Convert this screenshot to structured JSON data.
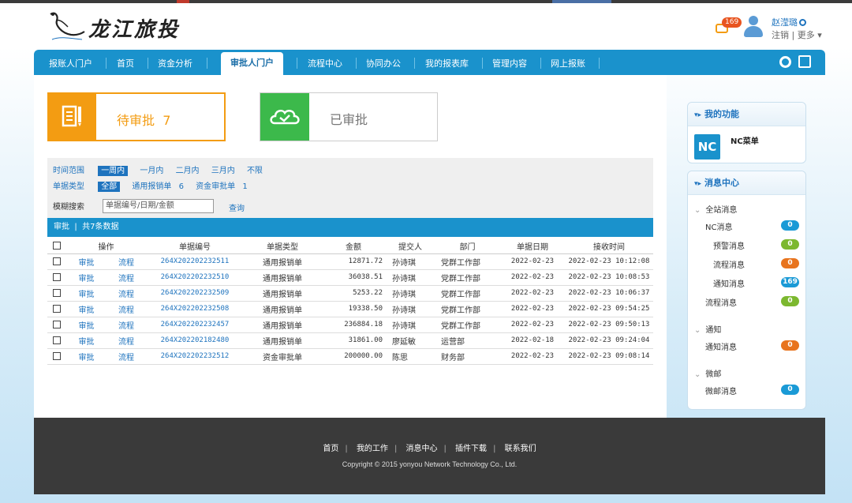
{
  "brand": {
    "logo_text": "龙江旅投"
  },
  "header": {
    "message_count": "169",
    "user_name": "赵滢璐",
    "logout": "注销",
    "separator": "|",
    "more": "更多 ▾"
  },
  "nav": {
    "items": [
      "报账人门户",
      "首页",
      "资金分析",
      "审批人门户",
      "流程中心",
      "协同办公",
      "我的报表库",
      "管理内容",
      "网上报账"
    ]
  },
  "cards": {
    "pending": {
      "label": "待审批",
      "count": "7"
    },
    "done": {
      "label": "已审批"
    }
  },
  "filters": {
    "time_label": "时间范围",
    "time_options": [
      "一周内",
      "一月内",
      "二月内",
      "三月内",
      "不限"
    ],
    "type_label": "单据类型",
    "type_all": "全部",
    "type_options": [
      {
        "name": "通用报销单",
        "count": "6"
      },
      {
        "name": "资金审批单",
        "count": "1"
      }
    ],
    "search_label": "模糊搜索",
    "search_placeholder": "单据编号/日期/金额",
    "search_button": "查询"
  },
  "table": {
    "bar_title": "审批",
    "bar_sep": "|",
    "bar_count": "共7条数据",
    "headers": [
      "操作",
      "单据编号",
      "单据类型",
      "金额",
      "提交人",
      "部门",
      "单据日期",
      "接收时间"
    ],
    "rows": [
      {
        "action1": "审批",
        "action2": "流程",
        "code": "264X202202232511",
        "type": "通用报销单",
        "amount": "12871.72",
        "submitter": "孙诗琪",
        "dept": "党群工作部",
        "date": "2022-02-23",
        "received": "2022-02-23 10:12:08"
      },
      {
        "action1": "审批",
        "action2": "流程",
        "code": "264X202202232510",
        "type": "通用报销单",
        "amount": "36038.51",
        "submitter": "孙诗琪",
        "dept": "党群工作部",
        "date": "2022-02-23",
        "received": "2022-02-23 10:08:53"
      },
      {
        "action1": "审批",
        "action2": "流程",
        "code": "264X202202232509",
        "type": "通用报销单",
        "amount": "5253.22",
        "submitter": "孙诗琪",
        "dept": "党群工作部",
        "date": "2022-02-23",
        "received": "2022-02-23 10:06:37"
      },
      {
        "action1": "审批",
        "action2": "流程",
        "code": "264X202202232508",
        "type": "通用报销单",
        "amount": "19338.50",
        "submitter": "孙诗琪",
        "dept": "党群工作部",
        "date": "2022-02-23",
        "received": "2022-02-23 09:54:25"
      },
      {
        "action1": "审批",
        "action2": "流程",
        "code": "264X202202232457",
        "type": "通用报销单",
        "amount": "236884.18",
        "submitter": "孙诗琪",
        "dept": "党群工作部",
        "date": "2022-02-23",
        "received": "2022-02-23 09:50:13"
      },
      {
        "action1": "审批",
        "action2": "流程",
        "code": "264X202202182480",
        "type": "通用报销单",
        "amount": "31861.00",
        "submitter": "廖延敏",
        "dept": "运营部",
        "date": "2022-02-18",
        "received": "2022-02-23 09:24:04"
      },
      {
        "action1": "审批",
        "action2": "流程",
        "code": "264X202202232512",
        "type": "资金审批单",
        "amount": "200000.00",
        "submitter": "陈思",
        "dept": "财务部",
        "date": "2022-02-23",
        "received": "2022-02-23 09:08:14"
      }
    ]
  },
  "sidebar": {
    "functions_title": "我的功能",
    "nc_logo": "NC",
    "nc_menu": "NC菜单",
    "messages_title": "消息中心",
    "groups": [
      {
        "label": "全站消息"
      },
      {
        "label": "通知"
      },
      {
        "label": "微邮"
      }
    ],
    "items": [
      {
        "label": "NC消息",
        "count": "0",
        "color": "#1a9ad6"
      },
      {
        "label": "预警消息",
        "count": "0",
        "color": "#7cb82f"
      },
      {
        "label": "流程消息",
        "count": "0",
        "color": "#e8741e"
      },
      {
        "label": "通知消息",
        "count": "169",
        "color": "#1a9ad6"
      },
      {
        "label": "流程消息",
        "count": "0",
        "color": "#7cb82f"
      },
      {
        "label": "通知消息",
        "count": "0",
        "color": "#e8741e"
      },
      {
        "label": "微邮消息",
        "count": "0",
        "color": "#1a9ad6"
      }
    ]
  },
  "footer": {
    "links": [
      "首页",
      "我的工作",
      "消息中心",
      "插件下载",
      "联系我们"
    ],
    "separator": "|",
    "copyright": "Copyright © 2015 yonyou Network Technology Co., Ltd."
  }
}
